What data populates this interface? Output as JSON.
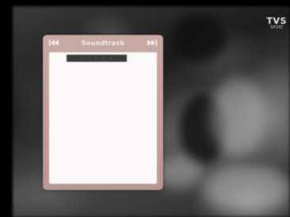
{
  "channel": {
    "logo_name": "TVS",
    "logo_sub": "SPORT"
  },
  "osd": {
    "title": "Soundtrack",
    "prev_icon": "skip-previous-icon",
    "next_icon": "skip-next-icon",
    "selected_item": "· · · · ·",
    "panel_color": "#c9a9a4",
    "list_background": "#fbf9f9",
    "highlight_color": "#3c3c3c"
  }
}
